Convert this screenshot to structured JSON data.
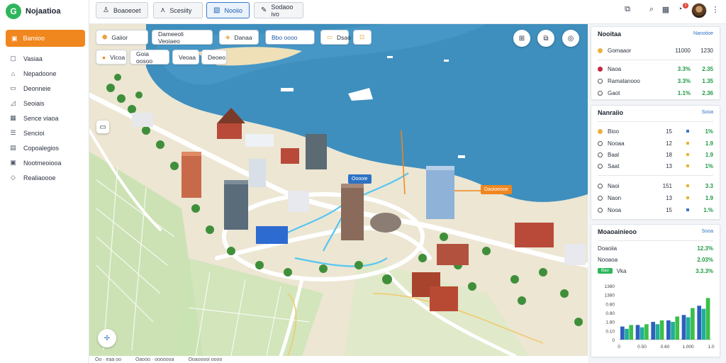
{
  "app": {
    "name": "Nojaatioa",
    "logo_letter": "G"
  },
  "sidebar": {
    "primary": {
      "label": "Bamioo",
      "icon": "file-icon"
    },
    "items": [
      {
        "label": "Vasiaa",
        "icon": "square-icon"
      },
      {
        "label": "Nepadoone",
        "icon": "home-icon"
      },
      {
        "label": "Deonneie",
        "icon": "monitor-icon"
      },
      {
        "label": "Seoiais",
        "icon": "chart-icon"
      },
      {
        "label": "Sence viaoa",
        "icon": "building-icon"
      },
      {
        "label": "Sencioi",
        "icon": "list-icon"
      },
      {
        "label": "Copoalegios",
        "icon": "grid-icon"
      },
      {
        "label": "Nootmeoiooa",
        "icon": "image-icon"
      },
      {
        "label": "Realiaoooe",
        "icon": "tag-icon"
      }
    ]
  },
  "toolbar": {
    "buttons": [
      {
        "label": "Boaoeoet",
        "icon": "person-icon",
        "active": false
      },
      {
        "label": "Scesiity",
        "icon": "route-icon",
        "active": false
      },
      {
        "label": "Nooiio",
        "icon": "map-icon",
        "active": true
      },
      {
        "label": "Sodaoo ivo",
        "icon": "edit-icon",
        "active": false
      }
    ],
    "notification_count": "3"
  },
  "map": {
    "chips_row1": [
      {
        "label": "Gaiior",
        "icon": "shield-icon"
      },
      {
        "label": "Dameeoli Veoiaeo",
        "icon": "",
        "blue": false
      },
      {
        "label": "Danaa",
        "icon": "layers-icon"
      },
      {
        "label": "Bbo oooo",
        "icon": "",
        "blue": true
      },
      {
        "label": "Dsao",
        "icon": "bus-icon"
      },
      {
        "label": "",
        "icon": "box-icon"
      }
    ],
    "chips_row2": [
      {
        "label": "Vicoa",
        "icon": "pin-icon"
      },
      {
        "label": "Goia oosoo",
        "icon": ""
      },
      {
        "label": "Veoaa",
        "icon": ""
      },
      {
        "label": "Deoeo",
        "icon": ""
      }
    ],
    "tags": [
      {
        "label": "Ooooie",
        "color": "#2d72c4"
      },
      {
        "label": "Daoioeooe",
        "color": "#f0861e"
      }
    ],
    "status": [
      "Oo · eaa oo",
      "Oaooo · ooooooa",
      "Ooaooooi oooo"
    ]
  },
  "panel_stats": {
    "title": "Nooitaa",
    "link": "Nanotioe",
    "top": {
      "label": "Gomaaor",
      "v1": "11000",
      "v2": "1230"
    },
    "rows": [
      {
        "label": "Naoa",
        "v1": "3.3%",
        "v2": "2.35",
        "color": "#c2263b"
      },
      {
        "label": "Ramatanooo",
        "v1": "3.3%",
        "v2": "1.35",
        "color": ""
      },
      {
        "label": "Gaot",
        "v1": "1.1%",
        "v2": "2.36",
        "color": ""
      }
    ]
  },
  "panel_list": {
    "title": "Nanraiio",
    "link": "Sooa",
    "rows": [
      {
        "label": "Bioo",
        "v1": "15",
        "v2": "1%",
        "color": "#e9b33a",
        "sq": "#3a78c9"
      },
      {
        "label": "Nooaa",
        "v1": "12",
        "v2": "1.9",
        "color": "",
        "sq": "#e9b33a"
      },
      {
        "label": "Baal",
        "v1": "18",
        "v2": "1.9",
        "color": "",
        "sq": "#e9b33a"
      },
      {
        "label": "Saat",
        "v1": "13",
        "v2": "1%",
        "color": "",
        "sq": "#e9b33a"
      },
      {
        "label": "Naoi",
        "v1": "151",
        "v2": "3.3",
        "color": "",
        "sq": "#e9b33a"
      },
      {
        "label": "Naon",
        "v1": "13",
        "v2": "1.9",
        "color": "",
        "sq": "#e9b33a"
      },
      {
        "label": "Nooa",
        "v1": "15",
        "v2": "1.%",
        "color": "",
        "sq": "#3a78c9"
      }
    ]
  },
  "panel_chart": {
    "title": "Moaoainieoo",
    "link": "Sooa",
    "rows": [
      {
        "label": "Doaoiia",
        "value": "12.3%"
      },
      {
        "label": "Nooaoa",
        "value": "2.03%"
      },
      {
        "label": "Vka",
        "value": "3.3.3%",
        "pill": "Bao"
      }
    ]
  },
  "chart_data": {
    "type": "bar",
    "title": "",
    "xlabel": "",
    "ylabel": "",
    "y_ticks": [
      "1380",
      "1380",
      "0.80",
      "0.80",
      "1.80",
      "0.10",
      "0"
    ],
    "x_ticks": [
      "0",
      "0.50",
      "0.60",
      "1.000",
      "1.0"
    ],
    "ylim": [
      0,
      7
    ],
    "series": [
      {
        "color": "#2d5fbf",
        "values": [
          1.7,
          1.9,
          2.3,
          2.5,
          3.2,
          4.4
        ]
      },
      {
        "color": "#1fae9a",
        "values": [
          1.4,
          1.6,
          2.0,
          2.3,
          2.9,
          4.0
        ]
      },
      {
        "color": "#3cbf4a",
        "values": [
          1.9,
          2.0,
          2.5,
          3.0,
          4.1,
          5.4
        ]
      }
    ],
    "grid": false,
    "legend": "none"
  }
}
